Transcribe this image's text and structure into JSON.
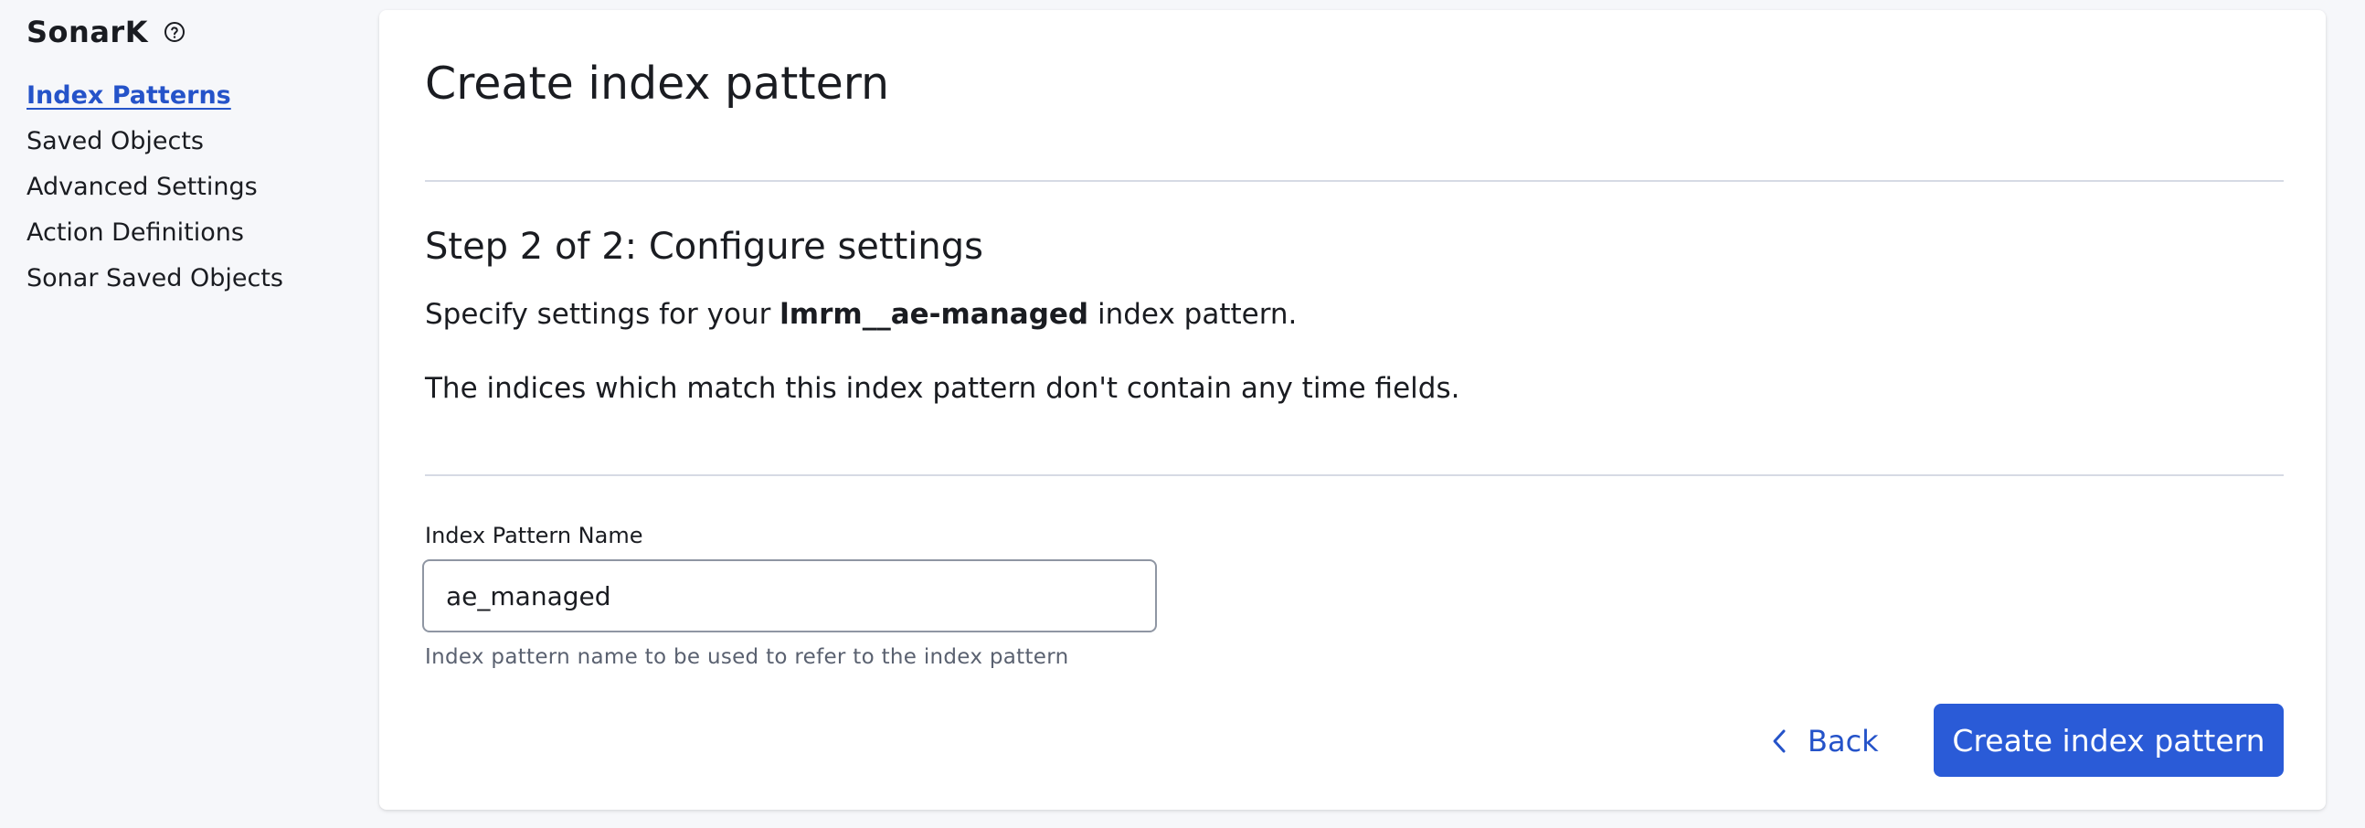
{
  "sidebar": {
    "app_title": "SonarK",
    "help_icon": "question-circle-icon",
    "items": [
      {
        "label": "Index Patterns",
        "active": true
      },
      {
        "label": "Saved Objects",
        "active": false
      },
      {
        "label": "Advanced Settings",
        "active": false
      },
      {
        "label": "Action Definitions",
        "active": false
      },
      {
        "label": "Sonar Saved Objects",
        "active": false
      }
    ]
  },
  "main": {
    "title": "Create index pattern",
    "step_title": "Step 2 of 2: Configure settings",
    "description_prefix": "Specify settings for your ",
    "pattern_name_bold": "lmrm__ae-managed",
    "description_suffix": " index pattern.",
    "time_fields_note": "The indices which match this index pattern don't contain any time fields.",
    "field": {
      "label": "Index Pattern Name",
      "value": "ae_managed",
      "help_text": "Index pattern name to be used to refer to the index pattern"
    },
    "back_button": {
      "label": "Back",
      "icon": "chevron-left-icon"
    },
    "create_button": {
      "label": "Create index pattern"
    }
  },
  "colors": {
    "accent": "#2a5bd7",
    "link": "#2553c9",
    "background": "#f6f7fa",
    "panel": "#ffffff",
    "divider": "#d6dae4"
  }
}
